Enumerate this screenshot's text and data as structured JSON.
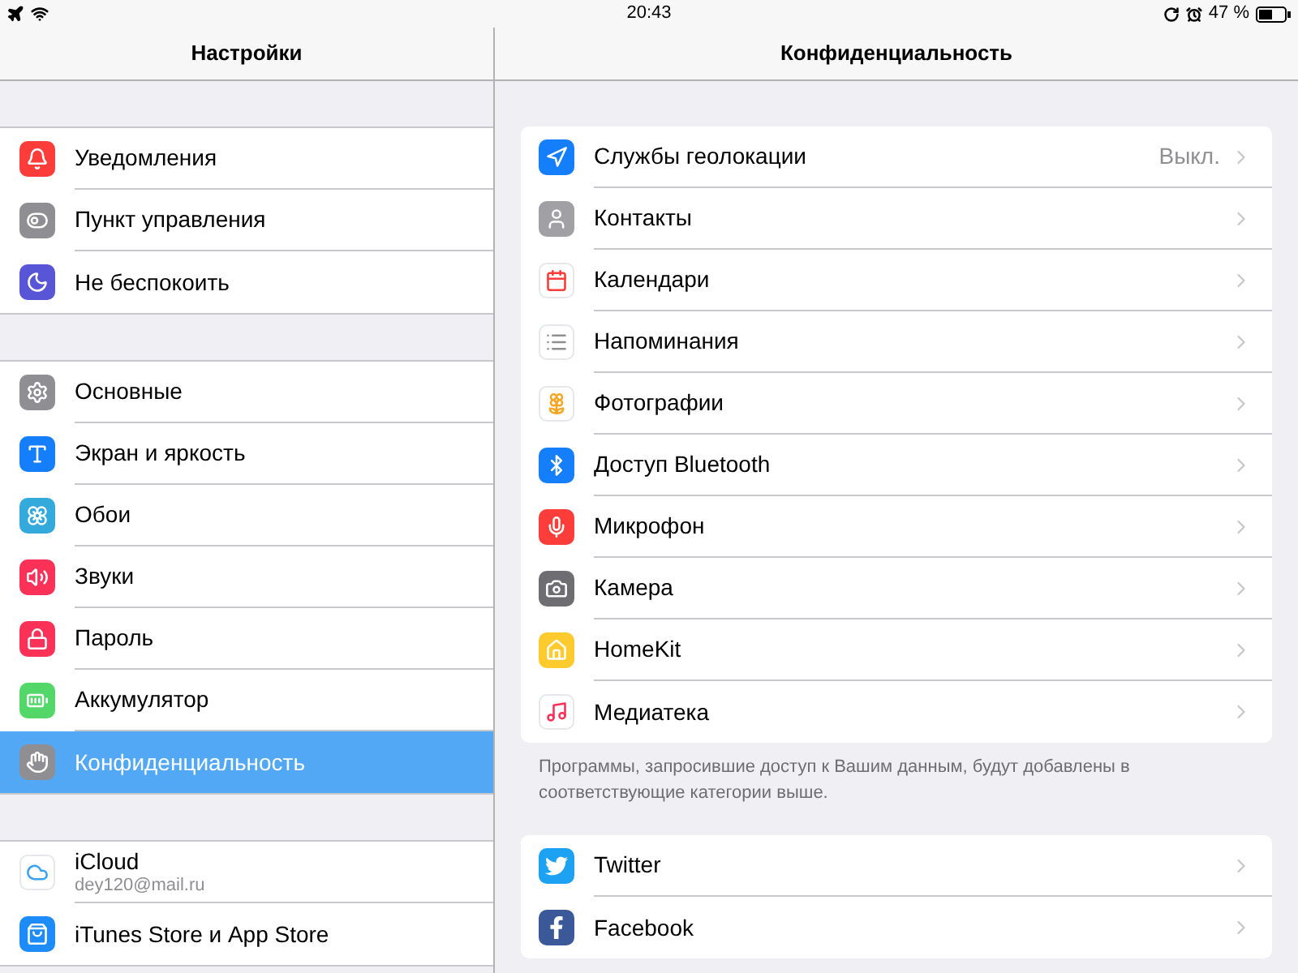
{
  "status_bar": {
    "time": "20:43",
    "battery": "47 %"
  },
  "sidebar": {
    "title": "Настройки",
    "groups": [
      {
        "items": [
          {
            "label": "Уведомления",
            "selected": false
          },
          {
            "label": "Пункт управления",
            "selected": false
          },
          {
            "label": "Не беспокоить",
            "selected": false
          }
        ]
      },
      {
        "items": [
          {
            "label": "Основные",
            "selected": false
          },
          {
            "label": "Экран и яркость",
            "selected": false
          },
          {
            "label": "Обои",
            "selected": false
          },
          {
            "label": "Звуки",
            "selected": false
          },
          {
            "label": "Пароль",
            "selected": false
          },
          {
            "label": "Аккумулятор",
            "selected": false
          },
          {
            "label": "Конфиденциальность",
            "selected": true
          }
        ]
      },
      {
        "items": [
          {
            "label": "iCloud",
            "subtitle": "dey120@mail.ru",
            "selected": false
          },
          {
            "label": "iTunes Store и App Store",
            "selected": false
          }
        ]
      }
    ]
  },
  "detail": {
    "title": "Конфиденциальность",
    "groups": [
      {
        "items": [
          {
            "label": "Службы геолокации",
            "value": "Выкл."
          },
          {
            "label": "Контакты"
          },
          {
            "label": "Календари"
          },
          {
            "label": "Напоминания"
          },
          {
            "label": "Фотографии"
          },
          {
            "label": "Доступ Bluetooth"
          },
          {
            "label": "Микрофон"
          },
          {
            "label": "Камера"
          },
          {
            "label": "HomeKit"
          },
          {
            "label": "Медиатека"
          }
        ],
        "footer": "Программы, запросившие доступ к Вашим данным, будут добавлены в соответствующие категории выше."
      },
      {
        "items": [
          {
            "label": "Twitter"
          },
          {
            "label": "Facebook"
          }
        ]
      }
    ]
  }
}
